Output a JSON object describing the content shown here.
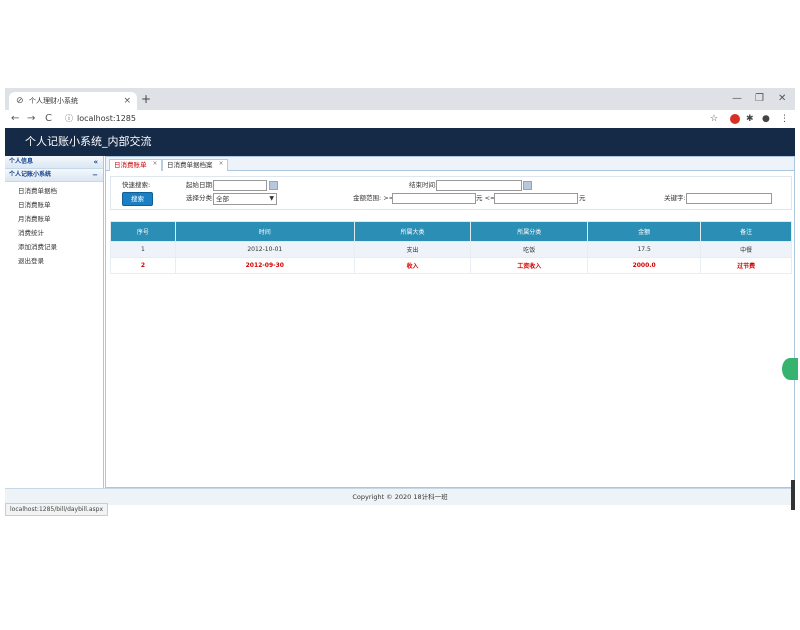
{
  "browser": {
    "tab_title": "个人理财小系统",
    "tab_close": "×",
    "new_tab": "+",
    "url": "localhost:1285",
    "status_url": "localhost:1285/bill/daybill.aspx",
    "controls": {
      "minimize": "—",
      "restore": "❐",
      "close": "✕"
    }
  },
  "app": {
    "title": "个人记账小系统_内部交流"
  },
  "sidebar": {
    "sections": [
      {
        "label": "个人信息",
        "toggle": "«"
      },
      {
        "label": "个人记账小系统",
        "toggle": "−"
      }
    ],
    "items": [
      "日消费单据档",
      "日消费账单",
      "月消费账单",
      "消费统计",
      "添加消费记录",
      "退出登录"
    ]
  },
  "content_tabs": [
    {
      "label": "日消费账单",
      "close": "×"
    },
    {
      "label": "日消费单据档案",
      "close": "×"
    }
  ],
  "search_form": {
    "fuzzy_label": "快速搜索:",
    "start_date_label": "起始日期:",
    "end_date_label": "结束时间:",
    "category_label": "选择分类:",
    "category_value": "全部",
    "amount_range_label": "金额范围: >=",
    "amount_unit_1": "元 <=",
    "amount_unit_2": "元",
    "keyword_label": "关键字:",
    "search_button": "搜索"
  },
  "table": {
    "headers": [
      "序号",
      "时间",
      "所属大类",
      "所属分类",
      "金额",
      "备注"
    ],
    "rows": [
      [
        "1",
        "2012-10-01",
        "支出",
        "吃饭",
        "17.5",
        "中餐"
      ],
      [
        "2",
        "2012-09-30",
        "收入",
        "工资收入",
        "2000.0",
        "过节费"
      ]
    ]
  },
  "footer": {
    "copyright": "Copyright © 2020 18计科一班"
  }
}
